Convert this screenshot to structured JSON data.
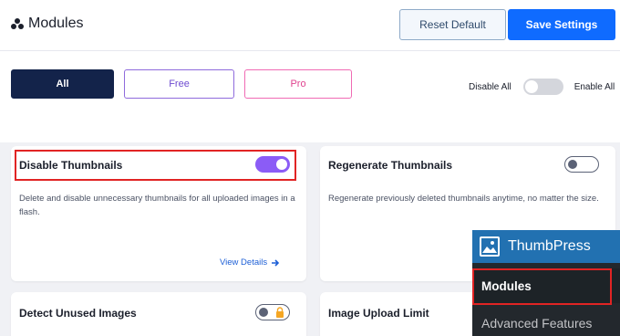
{
  "header": {
    "title": "Modules",
    "reset_label": "Reset Default",
    "save_label": "Save Settings"
  },
  "filters": {
    "tabs": [
      {
        "label": "All",
        "active": true
      },
      {
        "label": "Free",
        "active": false
      },
      {
        "label": "Pro",
        "active": false
      }
    ],
    "disable_all_label": "Disable All",
    "enable_all_label": "Enable All",
    "bulk_toggle_on": false
  },
  "modules": [
    {
      "title": "Disable Thumbnails",
      "description": "Delete and disable unnecessary thumbnails for all uploaded images in a flash.",
      "enabled": true,
      "link_label": "View Details",
      "highlighted": true
    },
    {
      "title": "Regenerate Thumbnails",
      "description": "Regenerate previously deleted thumbnails anytime, no matter the size.",
      "enabled": false
    },
    {
      "title": "Detect Unused Images",
      "enabled": false,
      "locked": true
    },
    {
      "title": "Image Upload Limit"
    }
  ],
  "wp_menu": {
    "plugin_name": "ThumbPress",
    "items": [
      {
        "label": "Modules",
        "active": true
      },
      {
        "label": "Advanced Features",
        "active": false
      }
    ]
  },
  "colors": {
    "accent_blue": "#0f6bff",
    "dark_navy": "#13234a",
    "toggle_on": "#8b5cf6",
    "highlight_red": "#e12424",
    "wp_blue": "#2271b1"
  }
}
